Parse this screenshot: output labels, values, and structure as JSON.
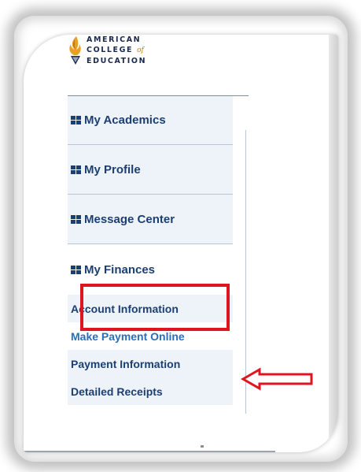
{
  "logo": {
    "line1": "AMERICAN",
    "line2": "COLLEGE",
    "line2_suffix": "of",
    "line3": "EDUCATION",
    "icon": "flame-torch-icon"
  },
  "menu": {
    "items": [
      {
        "label": "My Academics",
        "icon": "grid-icon"
      },
      {
        "label": "My Profile",
        "icon": "grid-icon"
      },
      {
        "label": "Message Center",
        "icon": "grid-icon"
      },
      {
        "label": "My Finances",
        "icon": "grid-icon"
      }
    ],
    "submenu": [
      {
        "label": "Account Information"
      },
      {
        "label": "Make Payment Online"
      },
      {
        "label": "Payment Information"
      },
      {
        "label": "Detailed Receipts"
      }
    ]
  },
  "colors": {
    "nav_text": "#1c3f72",
    "link_text": "#2a6db8",
    "nav_bg": "#eef3fa",
    "annotation": "#e0141e",
    "brand_orange": "#e8a020"
  }
}
